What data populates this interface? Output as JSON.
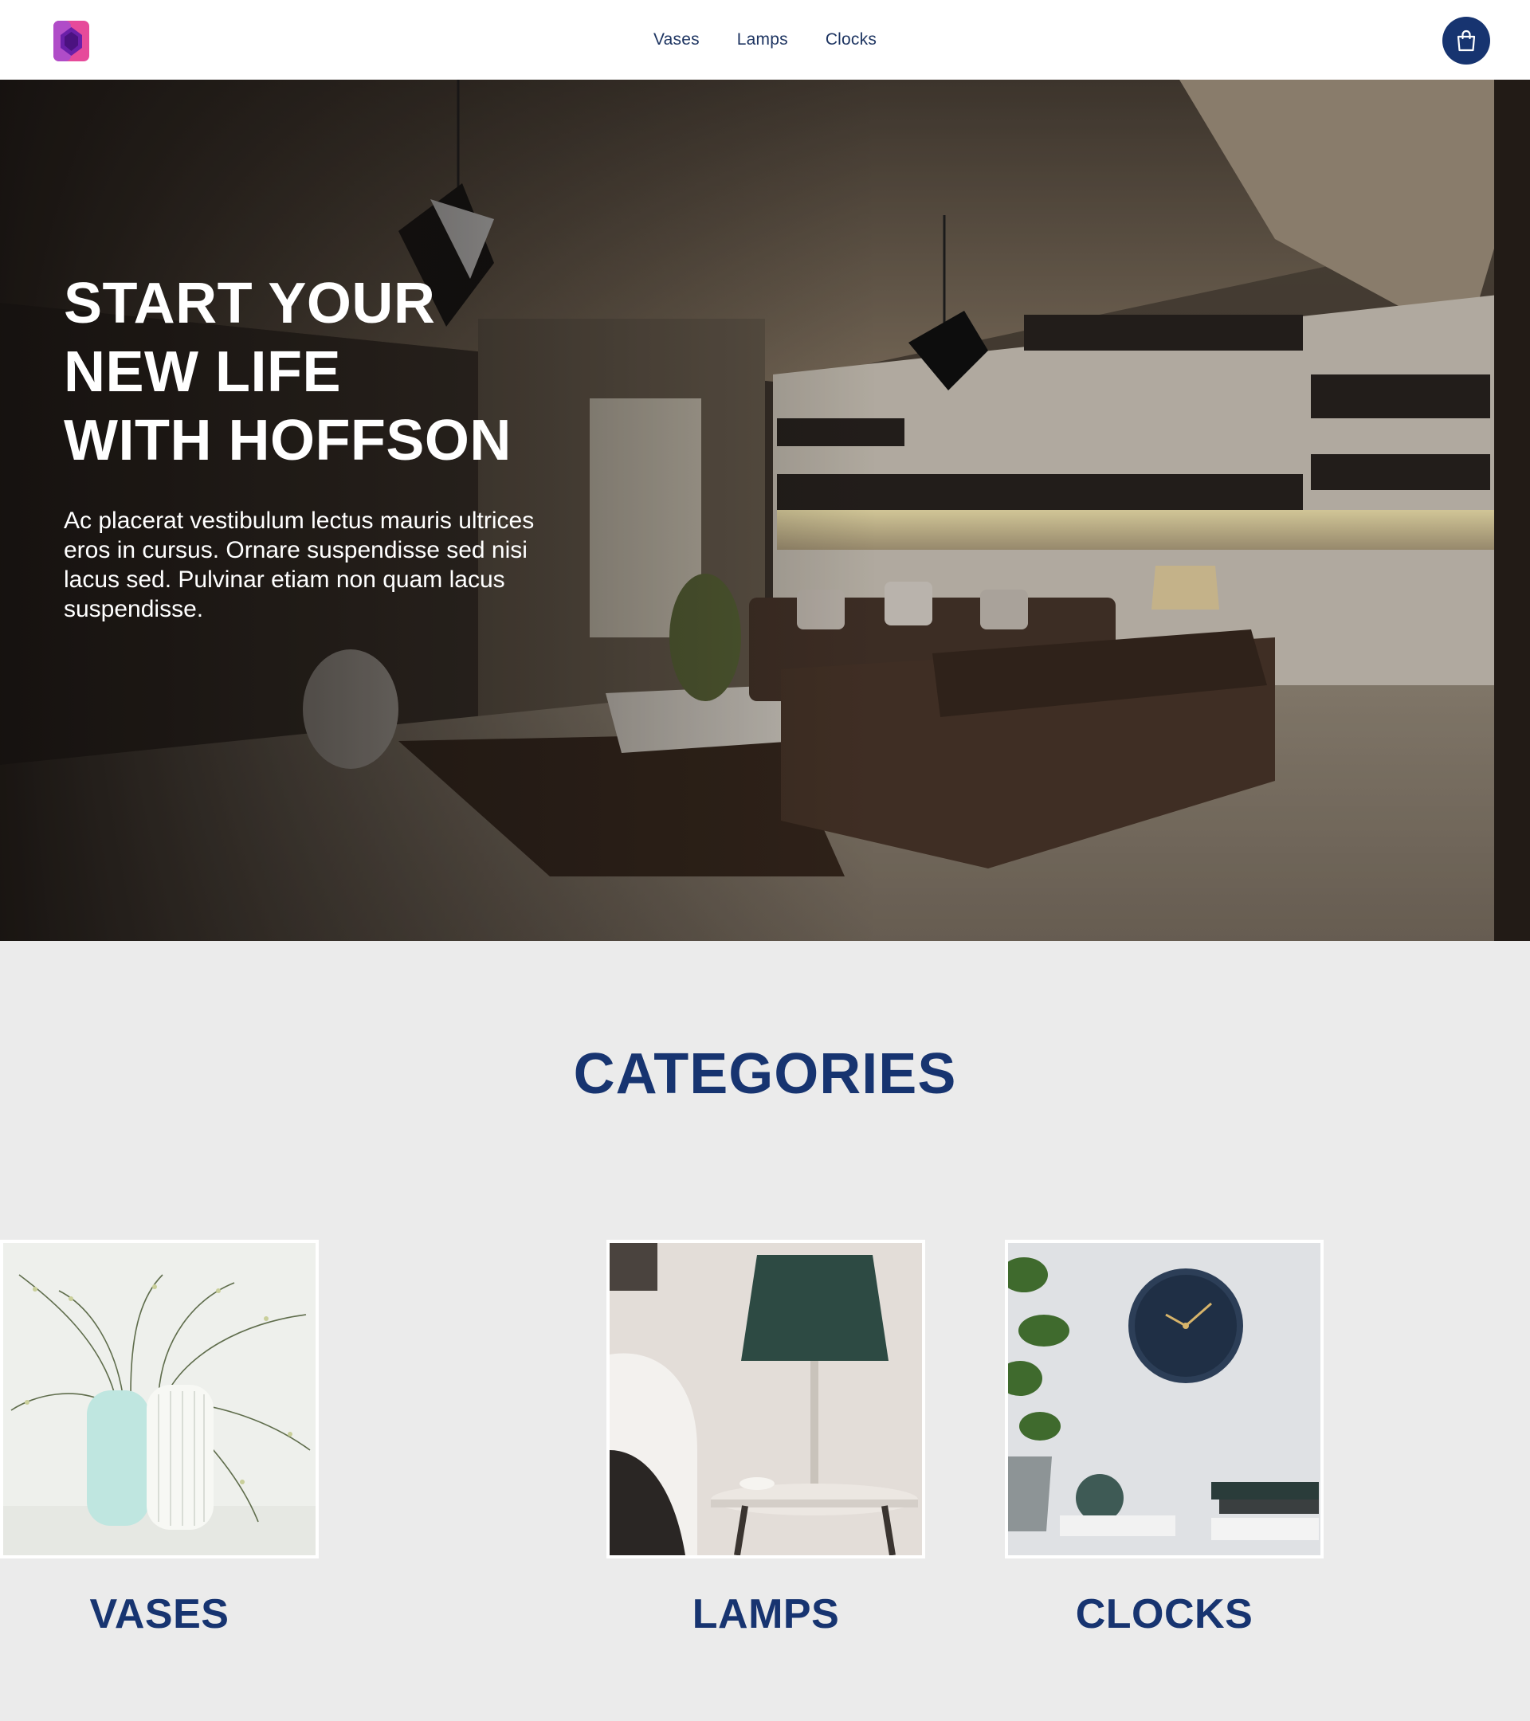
{
  "header": {
    "logo_icon": "hoffson-logo-icon",
    "nav": [
      {
        "label": "Vases"
      },
      {
        "label": "Lamps"
      },
      {
        "label": "Clocks"
      }
    ],
    "cart_icon": "shopping-bag-icon"
  },
  "hero": {
    "title": "START YOUR\nNEW LIFE\nWITH HOFFSON",
    "text": "Ac placerat vestibulum lectus mauris ultrices eros in cursus. Ornare suspendisse sed nisi lacus sed. Pulvinar etiam non quam lacus suspendisse."
  },
  "categories": {
    "title": "CATEGORIES",
    "items": [
      {
        "label": "VASES"
      },
      {
        "label": "LAMPS"
      },
      {
        "label": "CLOCKS"
      }
    ]
  },
  "colors": {
    "brand_navy": "#173470",
    "page_bg": "#ebebeb"
  }
}
